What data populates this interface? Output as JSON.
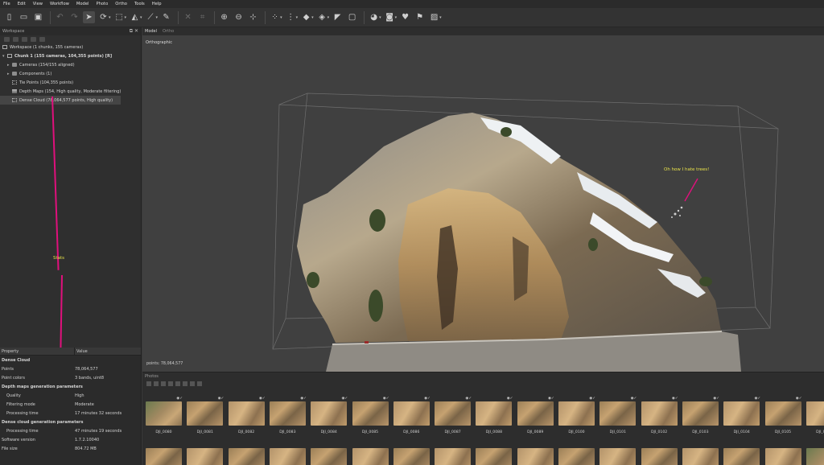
{
  "menu": [
    "File",
    "Edit",
    "View",
    "Workflow",
    "Model",
    "Photo",
    "Ortho",
    "Tools",
    "Help"
  ],
  "workspace": {
    "title": "Workspace",
    "items": [
      {
        "label": "Workspace (1 chunks, 155 cameras)",
        "level": 0
      },
      {
        "label": "Chunk 1 (155 cameras, 104,355 points) [R]",
        "level": 1,
        "bold": true
      },
      {
        "label": "Cameras (154/155 aligned)",
        "level": 2
      },
      {
        "label": "Components (1)",
        "level": 2
      },
      {
        "label": "Tie Points (104,355 points)",
        "level": 2
      },
      {
        "label": "Depth Maps (154, High quality, Moderate filtering)",
        "level": 2
      },
      {
        "label": "Dense Cloud (78,064,577 points, High quality)",
        "level": 2
      }
    ]
  },
  "annotations": {
    "stats": "Stats",
    "trees": "Oh how I hate trees!"
  },
  "properties": {
    "header_property": "Property",
    "header_value": "Value",
    "rows": [
      {
        "k": "Dense Cloud",
        "v": "",
        "section": true
      },
      {
        "k": "Points",
        "v": "78,064,577"
      },
      {
        "k": "Point colors",
        "v": "3 bands, uint8"
      },
      {
        "k": "Depth maps generation parameters",
        "v": "",
        "section": true
      },
      {
        "k": "Quality",
        "v": "High",
        "indent": true
      },
      {
        "k": "Filtering mode",
        "v": "Moderate",
        "indent": true
      },
      {
        "k": "Processing time",
        "v": "17 minutes 32 seconds",
        "indent": true
      },
      {
        "k": "Dense cloud generation parameters",
        "v": "",
        "section": true
      },
      {
        "k": "Processing time",
        "v": "47 minutes 19 seconds",
        "indent": true
      },
      {
        "k": "Software version",
        "v": "1.7.2.10040"
      },
      {
        "k": "File size",
        "v": "804.72 MB"
      }
    ]
  },
  "model_tabs": [
    "Model",
    "Ortho"
  ],
  "viewport": {
    "mode_label": "Orthographic",
    "points_readout": "points: 78,064,577"
  },
  "photos": {
    "title": "Photos",
    "labels": [
      "DJI_0080",
      "DJI_0081",
      "DJI_0082",
      "DJI_0083",
      "DJI_0084",
      "DJI_0085",
      "DJI_0086",
      "DJI_0087",
      "DJI_0088",
      "DJI_0089",
      "DJI_0100",
      "DJI_0101",
      "DJI_0102",
      "DJI_0103",
      "DJI_0104",
      "DJI_0105",
      "DJI_0106"
    ]
  }
}
